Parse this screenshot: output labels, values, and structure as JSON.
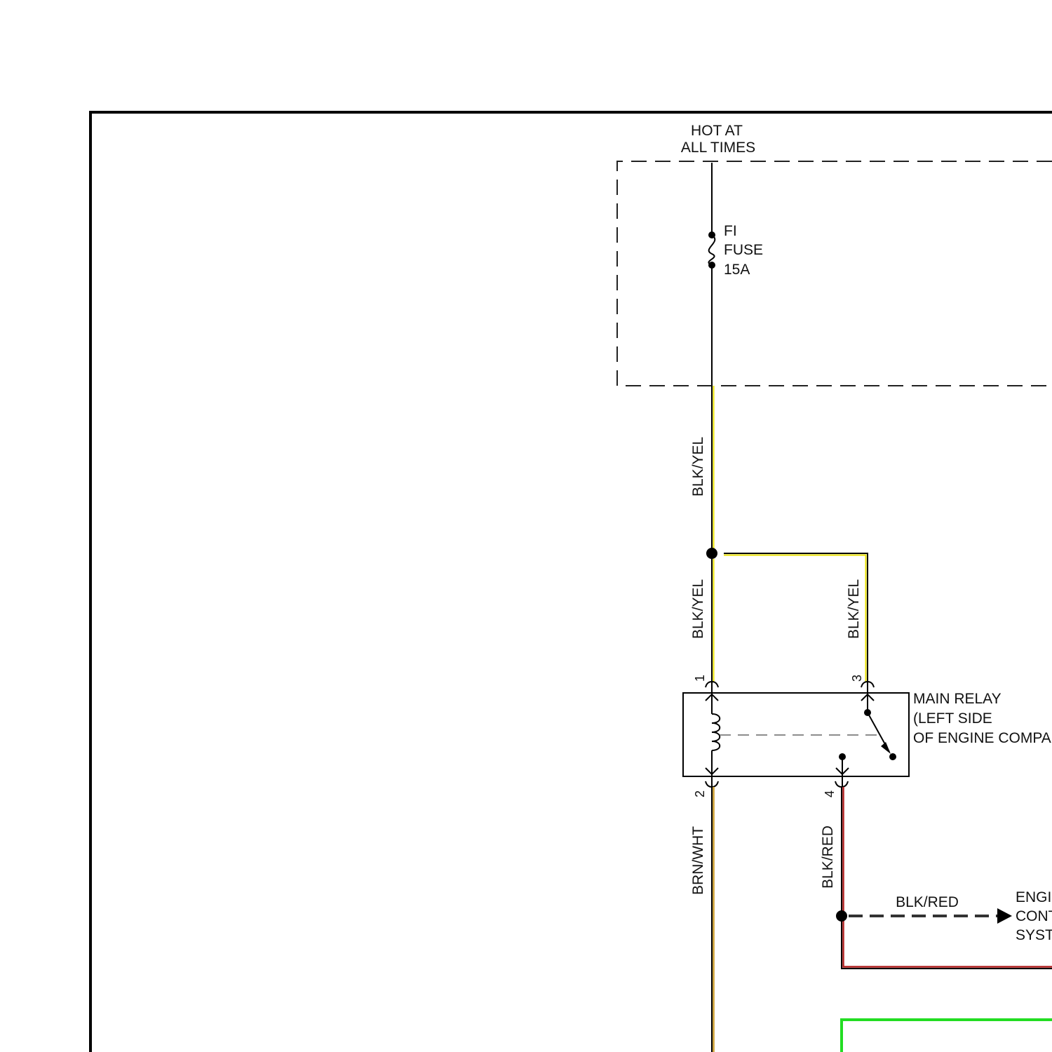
{
  "power_source": {
    "line1": "HOT AT",
    "line2": "ALL TIMES"
  },
  "fuse": {
    "name": "FI",
    "type": "FUSE",
    "rating": "15A"
  },
  "wires": {
    "feed": "BLK/YEL",
    "relay_pin1": "BLK/YEL",
    "relay_pin3": "BLK/YEL",
    "relay_pin2": "BRN/WHT",
    "relay_pin4": "BLK/RED",
    "to_engine_controls": "BLK/RED"
  },
  "relay": {
    "line1": "MAIN RELAY",
    "line2": "(LEFT SIDE",
    "line3": "OF ENGINE COMPA",
    "pins": {
      "p1": "1",
      "p2": "2",
      "p3": "3",
      "p4": "4"
    }
  },
  "destination": {
    "line1": "ENGI",
    "line2": "CONT",
    "line3": "SYST"
  },
  "colors": {
    "frame": "#000000",
    "wire_blk": "#000000",
    "wire_yel": "#e8e000",
    "wire_brn": "#c89a2a",
    "wire_red": "#b02020",
    "wire_grn": "#22dd22",
    "dashed_box": "#222222"
  }
}
